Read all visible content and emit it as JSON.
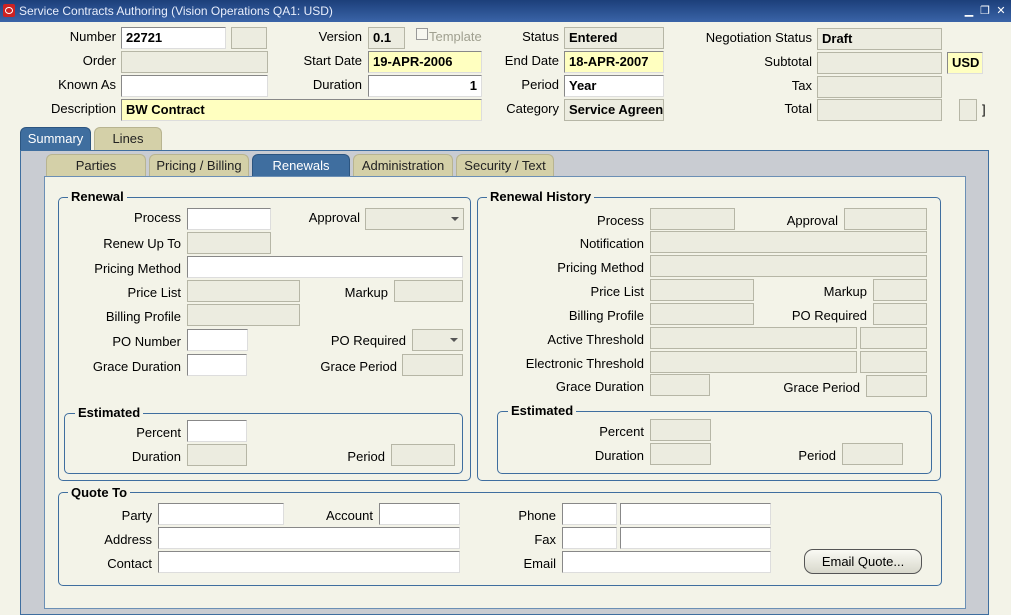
{
  "window": {
    "title": "Service Contracts Authoring (Vision Operations QA1: USD)"
  },
  "header": {
    "number_label": "Number",
    "number_value": "22721",
    "version_label": "Version",
    "version_value": "0.1",
    "template_label": "Template",
    "status_label": "Status",
    "status_value": "Entered",
    "negotiation_status_label": "Negotiation Status",
    "negotiation_status_value": "Draft",
    "order_label": "Order",
    "start_date_label": "Start Date",
    "start_date_value": "19-APR-2006",
    "end_date_label": "End Date",
    "end_date_value": "18-APR-2007",
    "subtotal_label": "Subtotal",
    "currency_value": "USD",
    "known_as_label": "Known As",
    "duration_label": "Duration",
    "duration_value": "1",
    "period_label": "Period",
    "period_value": "Year",
    "tax_label": "Tax",
    "description_label": "Description",
    "description_value": "BW Contract",
    "category_label": "Category",
    "category_value": "Service Agreen",
    "total_label": "Total",
    "total_bracket": "]"
  },
  "tabs": [
    "Summary",
    "Lines"
  ],
  "subtabs": [
    "Parties",
    "Pricing / Billing",
    "Renewals",
    "Administration",
    "Security / Text"
  ],
  "renewal": {
    "title": "Renewal",
    "process": "Process",
    "approval": "Approval",
    "renew_up_to": "Renew Up To",
    "pricing_method": "Pricing Method",
    "price_list": "Price List",
    "markup": "Markup",
    "billing_profile": "Billing Profile",
    "po_number": "PO Number",
    "po_required": "PO Required",
    "grace_duration": "Grace Duration",
    "grace_period": "Grace Period",
    "estimated": {
      "title": "Estimated",
      "percent": "Percent",
      "duration": "Duration",
      "period": "Period"
    }
  },
  "history": {
    "title": "Renewal History",
    "process": "Process",
    "approval": "Approval",
    "notification": "Notification",
    "pricing_method": "Pricing Method",
    "price_list": "Price List",
    "markup": "Markup",
    "billing_profile": "Billing Profile",
    "po_required": "PO Required",
    "active_threshold": "Active Threshold",
    "electronic_threshold": "Electronic Threshold",
    "grace_duration": "Grace Duration",
    "grace_period": "Grace Period",
    "estimated": {
      "title": "Estimated",
      "percent": "Percent",
      "duration": "Duration",
      "period": "Period"
    }
  },
  "quote": {
    "title": "Quote To",
    "party": "Party",
    "account": "Account",
    "address": "Address",
    "contact": "Contact",
    "phone": "Phone",
    "fax": "Fax",
    "email": "Email",
    "email_quote_button": "Email Quote..."
  }
}
